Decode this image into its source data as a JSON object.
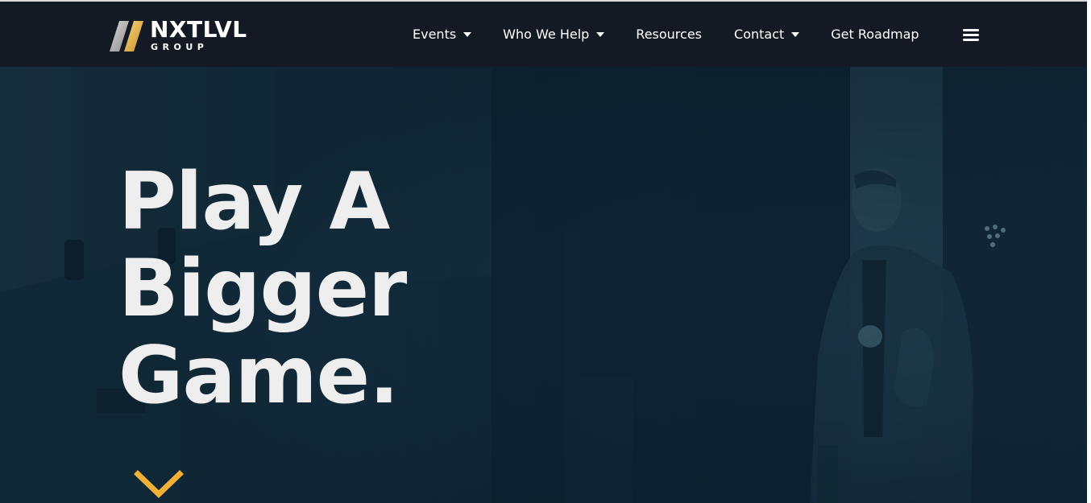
{
  "brand": {
    "name": "NXTLVL",
    "sub": "GROUP",
    "accent_color": "#f2b134",
    "nav_bg": "#141a24",
    "hero_bg": "#12293a"
  },
  "nav": {
    "items": [
      {
        "label": "Events",
        "has_dropdown": true
      },
      {
        "label": "Who We Help",
        "has_dropdown": true
      },
      {
        "label": "Resources",
        "has_dropdown": false
      },
      {
        "label": "Contact",
        "has_dropdown": true
      },
      {
        "label": "Get Roadmap",
        "has_dropdown": false
      }
    ],
    "menu_icon": "hamburger-menu-icon",
    "dropdown_icon": "caret-down-icon"
  },
  "hero": {
    "headline_lines": [
      "Play A",
      "Bigger",
      "Game."
    ],
    "scroll_icon": "chevron-down-icon"
  }
}
